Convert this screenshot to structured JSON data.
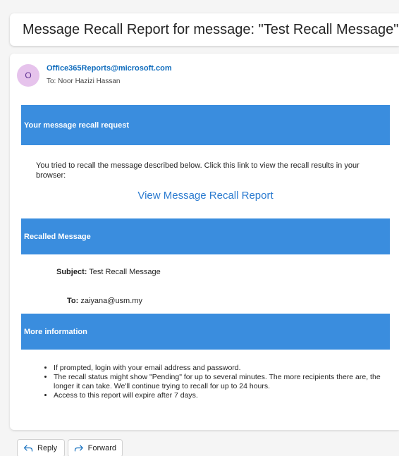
{
  "subject": {
    "title": "Message Recall Report for message: \"Test Recall Message\""
  },
  "sender": {
    "avatar_initial": "O",
    "email": "Office365Reports@microsoft.com",
    "to_line": "To:  Noor Hazizi Hassan"
  },
  "body": {
    "section1_title": "Your message recall request",
    "intro": "You tried to recall the message described below. Click this link to view the recall results in your browser:",
    "link_text": "View Message Recall Report",
    "section2_title": "Recalled Message",
    "subject_label": "Subject:",
    "subject_value": "Test Recall Message",
    "to_label": "To:",
    "to_value": "zaiyana@usm.my",
    "section3_title": "More information",
    "info_items": [
      "If prompted, login with your email address and password.",
      "The recall status might show \"Pending\" for up to several minutes. The more recipients there are, the longer it can take. We'll continue trying to recall for up to 24 hours.",
      "Access to this report will expire after 7 days."
    ]
  },
  "actions": {
    "reply_label": "Reply",
    "forward_label": "Forward"
  },
  "colors": {
    "section_bar": "#3a8dde",
    "link": "#2b7bd0",
    "sender_email": "#0f6cbd",
    "avatar_bg": "#e6c3ec"
  },
  "icons": {
    "reply": "reply-arrow-icon",
    "forward": "forward-arrow-icon"
  }
}
